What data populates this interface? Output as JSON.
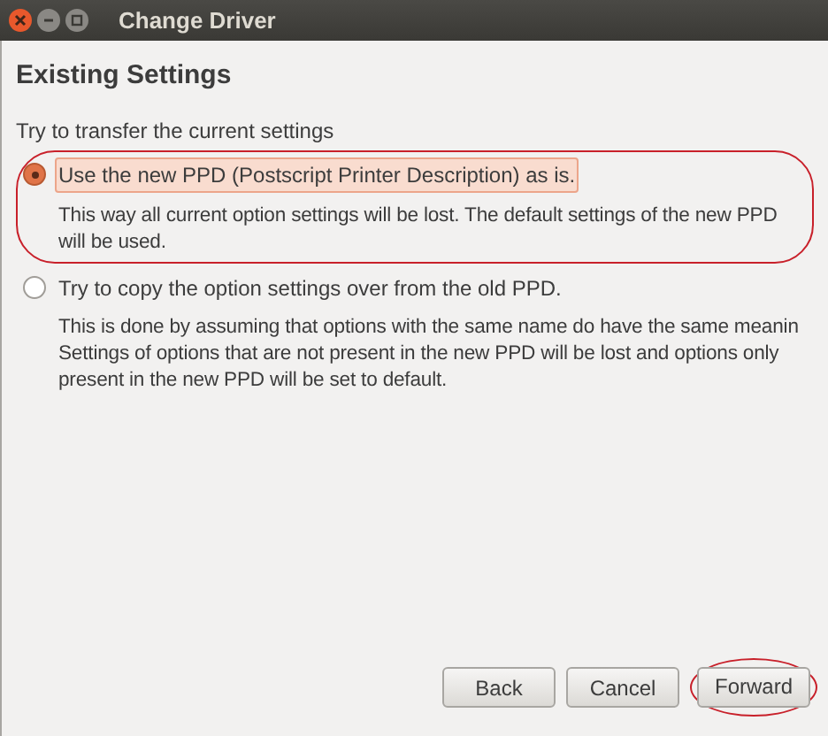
{
  "window": {
    "title": "Change Driver"
  },
  "heading": "Existing Settings",
  "intro": "Try to transfer the current settings",
  "options": [
    {
      "label": "Use the new PPD (Postscript Printer Description) as is.",
      "selected": true,
      "highlighted": true,
      "description": "This way all current option settings will be lost. The default settings of the new PPD\nwill be used."
    },
    {
      "label": "Try to copy the option settings over from the old PPD.",
      "selected": false,
      "highlighted": false,
      "description": "This is done by assuming that options with the same name do have the same meanin\nSettings of options that are not present in the new PPD will be lost and options only\npresent in the new PPD will be set to default."
    }
  ],
  "buttons": [
    {
      "label": "Back",
      "highlighted": false
    },
    {
      "label": "Cancel",
      "highlighted": false
    },
    {
      "label": "Forward",
      "highlighted": true
    }
  ]
}
